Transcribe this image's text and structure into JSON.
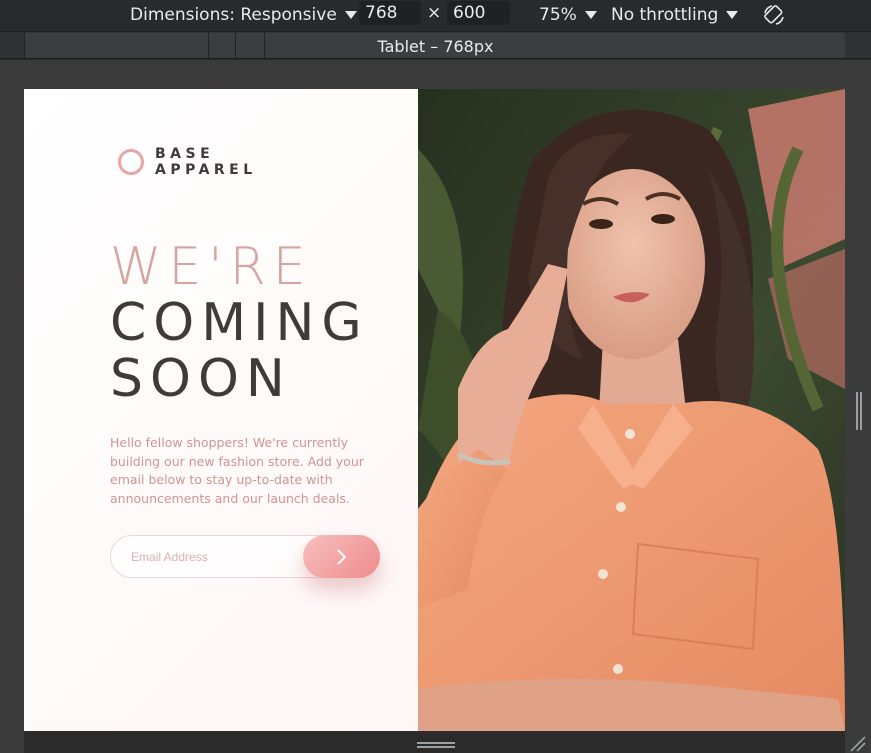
{
  "devtools": {
    "dimensions_label": "Dimensions: Responsive",
    "width_value": "768",
    "times_symbol": "×",
    "height_value": "600",
    "zoom_label": "75%",
    "throttling_label": "No throttling",
    "breakpoint_label": "Tablet – 768px"
  },
  "page": {
    "logo_top": "BASE",
    "logo_bottom": "APPAREL",
    "headline_light": "WE'RE",
    "headline_dark_1": "COMING",
    "headline_dark_2": "SOON",
    "description": "Hello fellow shoppers! We're currently building our new fashion store. Add your email below to stay up-to-date with announcements and our launch deals.",
    "email_placeholder": "Email Address",
    "submit_icon": "chevron-right-icon",
    "hero_image": "woman-in-peach-shirt-portrait"
  },
  "colors": {
    "accent_pink": "#ee8b8b",
    "headline_light": "#d8a3a3",
    "text_dark": "#3f3b3b",
    "description": "#cf9595"
  }
}
